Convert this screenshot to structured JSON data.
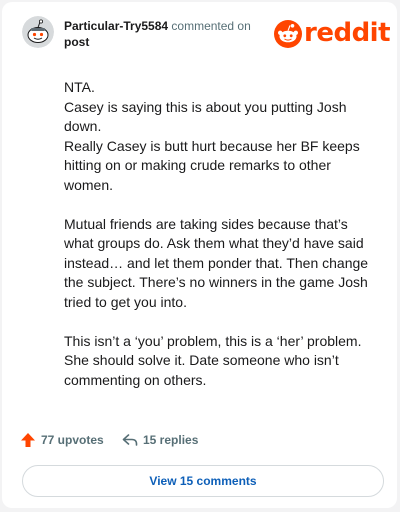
{
  "header": {
    "username": "Particular-Try5584",
    "commented_on": "commented on",
    "post_link": "post",
    "logo_text": "reddit",
    "brand_color": "#ff4500"
  },
  "comment": {
    "paragraphs": [
      [
        "NTA.",
        "Casey is saying this is about you putting Josh",
        "down.",
        "Really Casey is butt hurt because her BF keeps",
        "hitting on or making crude remarks to other",
        "women."
      ],
      [
        "Mutual friends are taking sides because that’s",
        "what groups do. Ask them what they’d have said",
        "instead… and let them ponder that. Then change",
        "the subject. There’s no winners in the game Josh",
        "tried to get you into."
      ],
      [
        "This isn’t a ‘you’ problem, this is a ‘her’ problem.",
        "She should solve it. Date someone who isn’t",
        "commenting on others."
      ]
    ]
  },
  "actions": {
    "upvotes": "77 upvotes",
    "replies": "15 replies",
    "upvote_icon": "upvote-arrow-icon",
    "reply_icon": "reply-arrow-icon"
  },
  "view_button": {
    "label": "View 15 comments",
    "color": "#0d5fb8"
  }
}
